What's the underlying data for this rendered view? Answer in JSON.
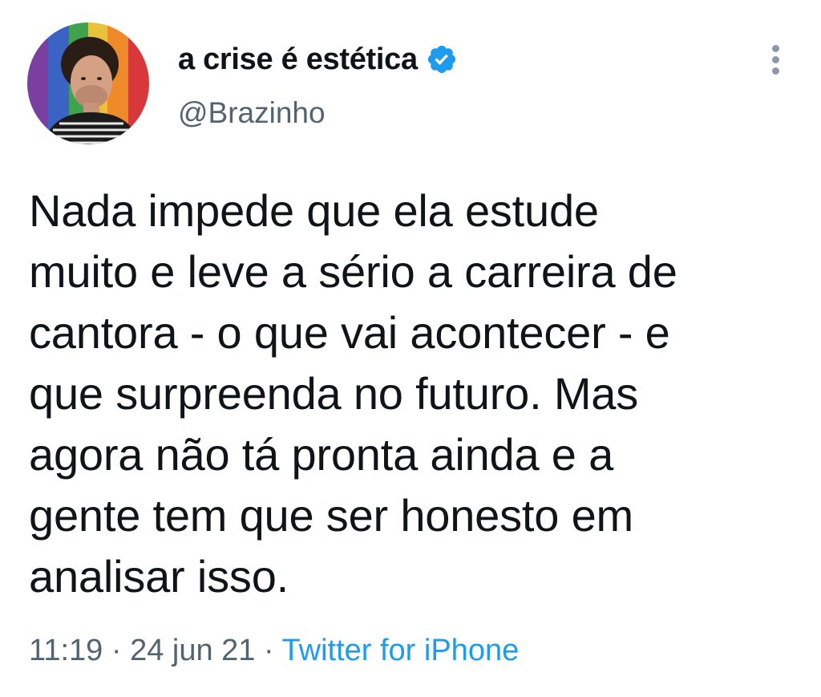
{
  "author": {
    "display_name": "a crise é estética",
    "handle": "@Brazinho",
    "verified": true,
    "avatar_icon": "profile-photo"
  },
  "tweet": {
    "text_lines": [
      "Nada impede que ela estude",
      "muito e leve a sério a carreira de",
      "cantora - o que vai acontecer - e",
      "que surpreenda no futuro. Mas",
      "agora não tá pronta ainda e a",
      "gente tem que ser honesto em",
      "analisar isso."
    ]
  },
  "meta": {
    "time": "11:19",
    "separator_1": " · ",
    "date": "24 jun 21",
    "separator_2": " · ",
    "source": "Twitter for iPhone"
  },
  "colors": {
    "text_primary": "#0f1419",
    "text_secondary": "#536471",
    "accent": "#1d9bf0",
    "background": "#ffffff"
  },
  "icons": {
    "verified": "verified-badge-icon",
    "more": "more-vertical-icon"
  }
}
